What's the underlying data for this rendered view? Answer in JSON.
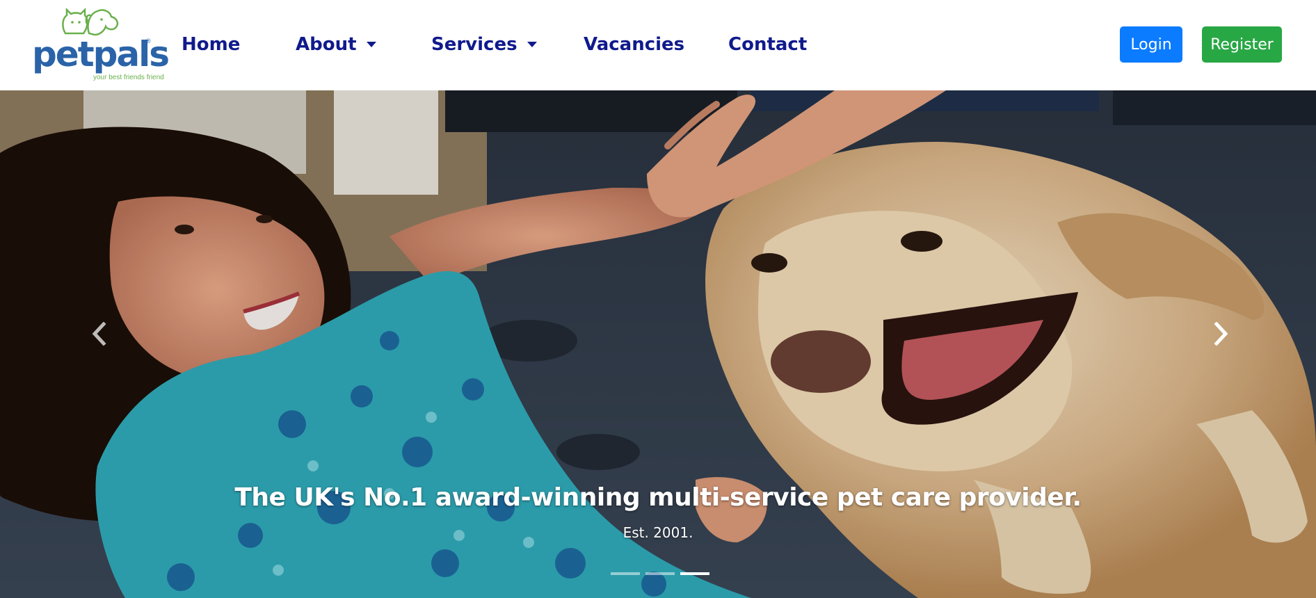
{
  "brand": {
    "name": "petpals",
    "tagline": "your best friends friend",
    "registered_mark": "®",
    "colors": {
      "blue": "#2a63a8",
      "green": "#6ab04c"
    }
  },
  "nav": {
    "items": [
      {
        "label": "Home",
        "dropdown": false
      },
      {
        "label": "About",
        "dropdown": true
      },
      {
        "label": "Services",
        "dropdown": true
      },
      {
        "label": "Vacancies",
        "dropdown": false
      },
      {
        "label": "Contact",
        "dropdown": false
      }
    ],
    "color": "#101a8c"
  },
  "auth": {
    "login_label": "Login",
    "register_label": "Register",
    "login_color": "#0b7bff",
    "register_color": "#28a745"
  },
  "carousel": {
    "caption_title": "The UK's No.1 award-winning multi-service pet care provider.",
    "caption_subtitle": "Est. 2001.",
    "slide_count": 3,
    "active_slide": 3,
    "prev_icon": "chevron-left-icon",
    "next_icon": "chevron-right-icon",
    "image_subject": "girl-petting-dog-photo"
  }
}
